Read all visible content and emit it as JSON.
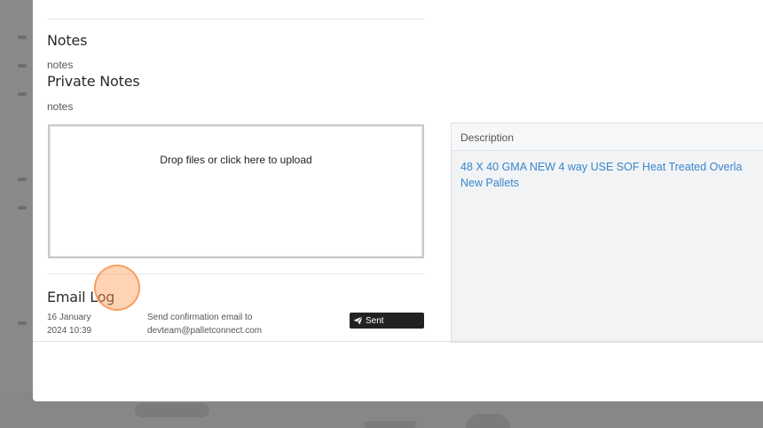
{
  "modal": {
    "notes": {
      "title": "Notes",
      "value": "notes"
    },
    "private_notes": {
      "title": "Private Notes",
      "value": "notes"
    },
    "upload": {
      "label": "Drop files or click here to upload"
    },
    "email_log": {
      "title": "Email Log",
      "entries": [
        {
          "date_line1": "16 January",
          "date_line2": "2024 10:39",
          "message_line1": "Send confirmation email to",
          "message_line2": "devteam@palletconnect.com",
          "status": "Sent"
        }
      ]
    },
    "description": {
      "header": "Description",
      "line1": "48 X 40 GMA NEW 4 way USE SOF Heat Treated Overla",
      "line2": "New Pallets"
    }
  },
  "colors": {
    "link_blue": "#3a85cc",
    "badge_dark": "#222222",
    "highlight_orange": "#f58c46"
  },
  "icons": {
    "sent": "paper-plane-icon"
  }
}
